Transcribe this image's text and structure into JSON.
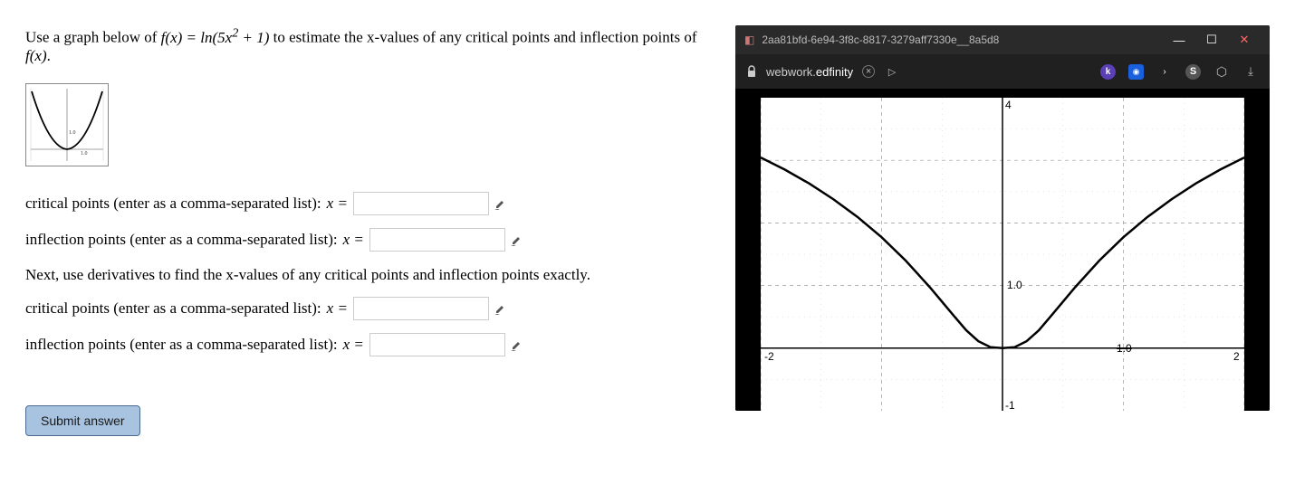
{
  "prompt_prefix": "Use a graph below of ",
  "prompt_function": "f(x) = ln(5x² + 1)",
  "prompt_suffix": " to estimate the x-values of any critical points and inflection points of ",
  "prompt_fof": "f(x)",
  "prompt_period": ".",
  "q1_label": "critical points (enter as a comma-separated list): ",
  "q1_var": "x =",
  "q2_label": "inflection points (enter as a comma-separated list): ",
  "q2_var": "x =",
  "instruction": "Next, use derivatives to find the x-values of any critical points and inflection points exactly.",
  "q3_label": "critical points (enter as a comma-separated list): ",
  "q3_var": "x =",
  "q4_label": "inflection points (enter as a comma-separated list): ",
  "q4_var": "x =",
  "submit_label": "Submit answer",
  "window": {
    "title": "2aa81bfd-6e94-3f8c-8817-3279aff7330e__8a5d8",
    "url_prefix": "webwork.",
    "url_domain": "edfinity"
  },
  "graph": {
    "y_top_label": "4",
    "x_left_label": "-2",
    "x_right_label": "2",
    "y_bottom_label": "-1",
    "tick_10": "1.0",
    "tick_right": "1.0"
  },
  "chart_data": {
    "type": "line",
    "title": "",
    "xlabel": "",
    "ylabel": "",
    "xlim": [
      -2,
      2
    ],
    "ylim": [
      -1,
      4
    ],
    "function": "ln(5*x^2 + 1)",
    "x": [
      -2.0,
      -1.6,
      -1.2,
      -0.8,
      -0.447,
      -0.2,
      0.0,
      0.2,
      0.447,
      0.8,
      1.2,
      1.6,
      2.0
    ],
    "y": [
      3.04,
      2.59,
      2.1,
      1.44,
      0.69,
      0.18,
      0.0,
      0.18,
      0.69,
      1.44,
      2.1,
      2.59,
      3.04
    ],
    "critical_points_x": [
      0
    ],
    "inflection_points_x": [
      -0.447,
      0.447
    ],
    "annotations": [
      {
        "x": 0,
        "y": 1.0,
        "text": "1.0"
      },
      {
        "x": 1.0,
        "y": 0,
        "text": "1.0"
      }
    ]
  }
}
